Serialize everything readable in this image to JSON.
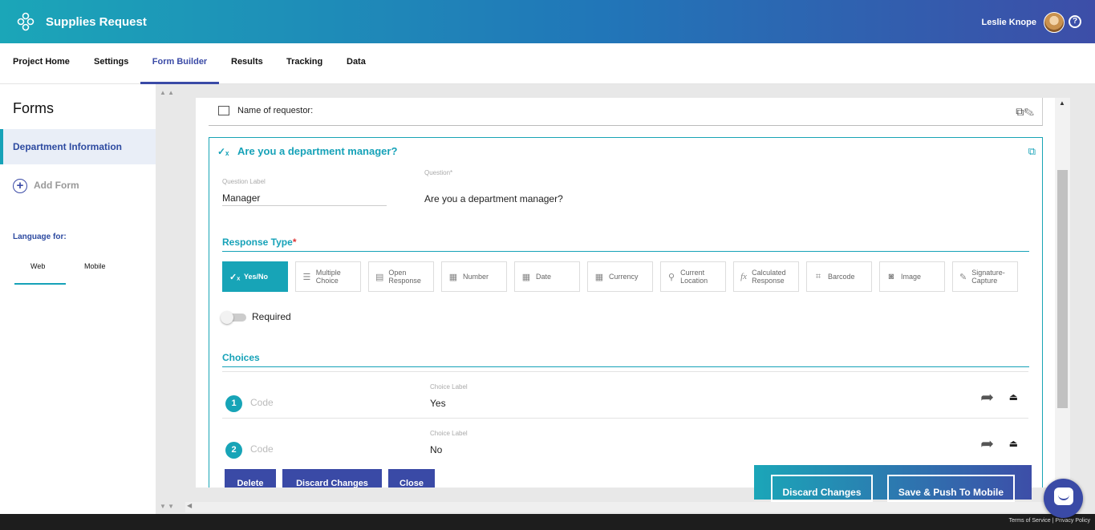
{
  "app": {
    "title": "Supplies Request",
    "user_name": "Leslie Knope",
    "help_glyph": "?"
  },
  "nav": {
    "tabs": [
      "Project Home",
      "Settings",
      "Form Builder",
      "Results",
      "Tracking",
      "Data"
    ],
    "active": "Form Builder"
  },
  "sidebar": {
    "heading": "Forms",
    "forms": [
      "Department Information"
    ],
    "add_form_label": "Add Form",
    "language_label": "Language for:",
    "language_tabs": [
      "Web",
      "Mobile"
    ]
  },
  "previous_question": {
    "text": "Name of requestor:"
  },
  "question": {
    "title": "Are you a department manager?",
    "question_label_caption": "Question Label",
    "question_label_value": "Manager",
    "question_caption": "Question*",
    "question_value": "Are you a department manager?",
    "response_type_heading": "Response Type",
    "required_asterisk": "*",
    "response_types": [
      {
        "label": "Yes/No",
        "icon": "yes-no-icon",
        "active": true
      },
      {
        "label": "Multiple Choice",
        "icon": "list-icon"
      },
      {
        "label": "Open Response",
        "icon": "text-box-icon"
      },
      {
        "label": "Number",
        "icon": "calculator-icon"
      },
      {
        "label": "Date",
        "icon": "calendar-icon"
      },
      {
        "label": "Currency",
        "icon": "calculator-icon"
      },
      {
        "label": "Current Location",
        "icon": "location-pin-icon"
      },
      {
        "label": "Calculated Response",
        "icon": "fx-icon"
      },
      {
        "label": "Barcode",
        "icon": "barcode-icon"
      },
      {
        "label": "Image",
        "icon": "camera-icon"
      },
      {
        "label": "Signature-Capture",
        "icon": "pen-icon"
      }
    ],
    "required_label": "Required",
    "required_on": false,
    "choices_heading": "Choices",
    "choices": [
      {
        "number": "1",
        "code_placeholder": "Code",
        "label_caption": "Choice Label",
        "label": "Yes"
      },
      {
        "number": "2",
        "code_placeholder": "Code",
        "label_caption": "Choice Label",
        "label": "No"
      }
    ],
    "buttons": {
      "delete": "Delete",
      "discard": "Discard Changes",
      "close": "Close"
    }
  },
  "floating_bar": {
    "discard": "Discard Changes",
    "save_push": "Save & Push To Mobile"
  },
  "footer": {
    "terms": "Terms of Service",
    "privacy": "Privacy Policy",
    "separator": "|"
  },
  "colors": {
    "teal": "#17a4b7",
    "indigo": "#3a4aa6"
  }
}
